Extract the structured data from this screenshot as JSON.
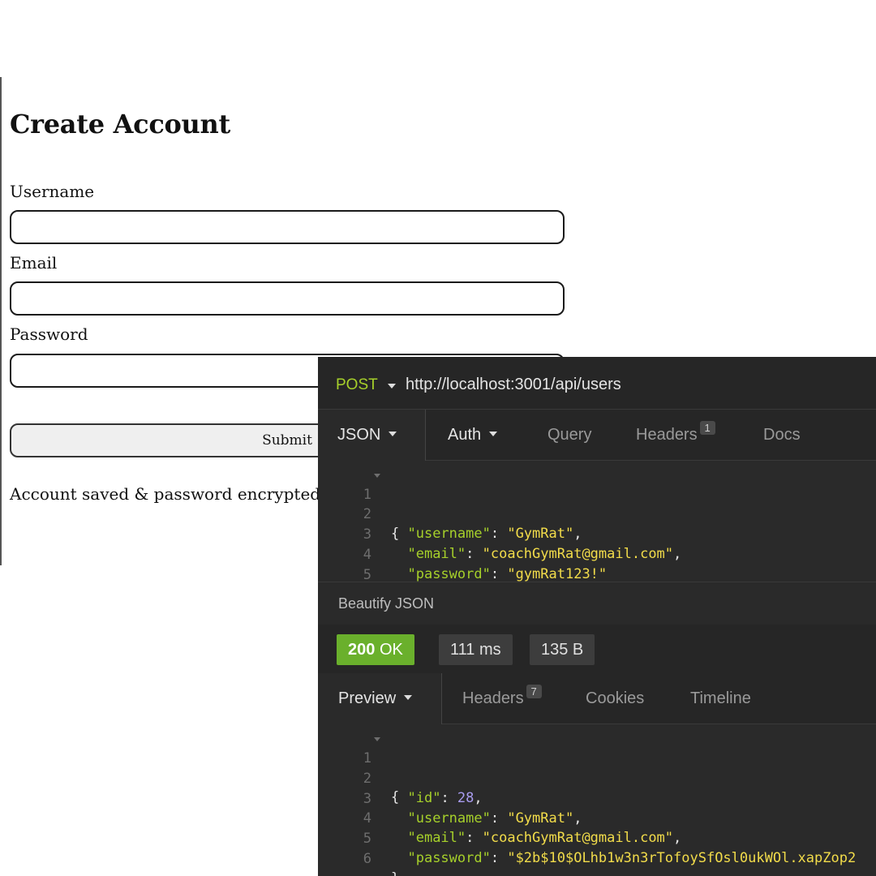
{
  "form": {
    "title": "Create Account",
    "username_label": "Username",
    "username_value": "",
    "email_label": "Email",
    "email_value": "",
    "password_label": "Password",
    "password_value": "",
    "submit_label": "Submit",
    "status_message": "Account saved & password encrypted."
  },
  "api_client": {
    "method": "POST",
    "url": "http://localhost:3001/api/users",
    "request_tabs": {
      "body": "JSON",
      "auth": "Auth",
      "query": "Query",
      "headers": "Headers",
      "headers_count": "1",
      "docs": "Docs"
    },
    "request_body": {
      "line_numbers": [
        "1",
        "2",
        "3",
        "4",
        "5"
      ],
      "username_key": "\"username\"",
      "username_value": "\"GymRat\"",
      "email_key": "\"email\"",
      "email_value": "\"coachGymRat@gmail.com\"",
      "password_key": "\"password\"",
      "password_value": "\"gymRat123!\""
    },
    "beautify_label": "Beautify JSON",
    "response_status": {
      "code": "200",
      "text": "OK",
      "time": "111 ms",
      "size": "135 B"
    },
    "response_tabs": {
      "preview": "Preview",
      "headers": "Headers",
      "headers_count": "7",
      "cookies": "Cookies",
      "timeline": "Timeline"
    },
    "response_body": {
      "line_numbers": [
        "1",
        "2",
        "3",
        "4",
        "5",
        "6"
      ],
      "id_key": "\"id\"",
      "id_value": "28",
      "username_key": "\"username\"",
      "username_value": "\"GymRat\"",
      "email_key": "\"email\"",
      "email_value": "\"coachGymRat@gmail.com\"",
      "password_key": "\"password\"",
      "password_value": "\"$2b$10$OLhb1w3n3rTofoySfOsl0ukWOl.xapZop2"
    }
  },
  "colors": {
    "json_key": "#a6d02a",
    "json_string": "#f2dc4a",
    "json_number": "#a99cf0",
    "status_ok": "#6ab02c",
    "panel_bg": "#2a2a2a"
  }
}
